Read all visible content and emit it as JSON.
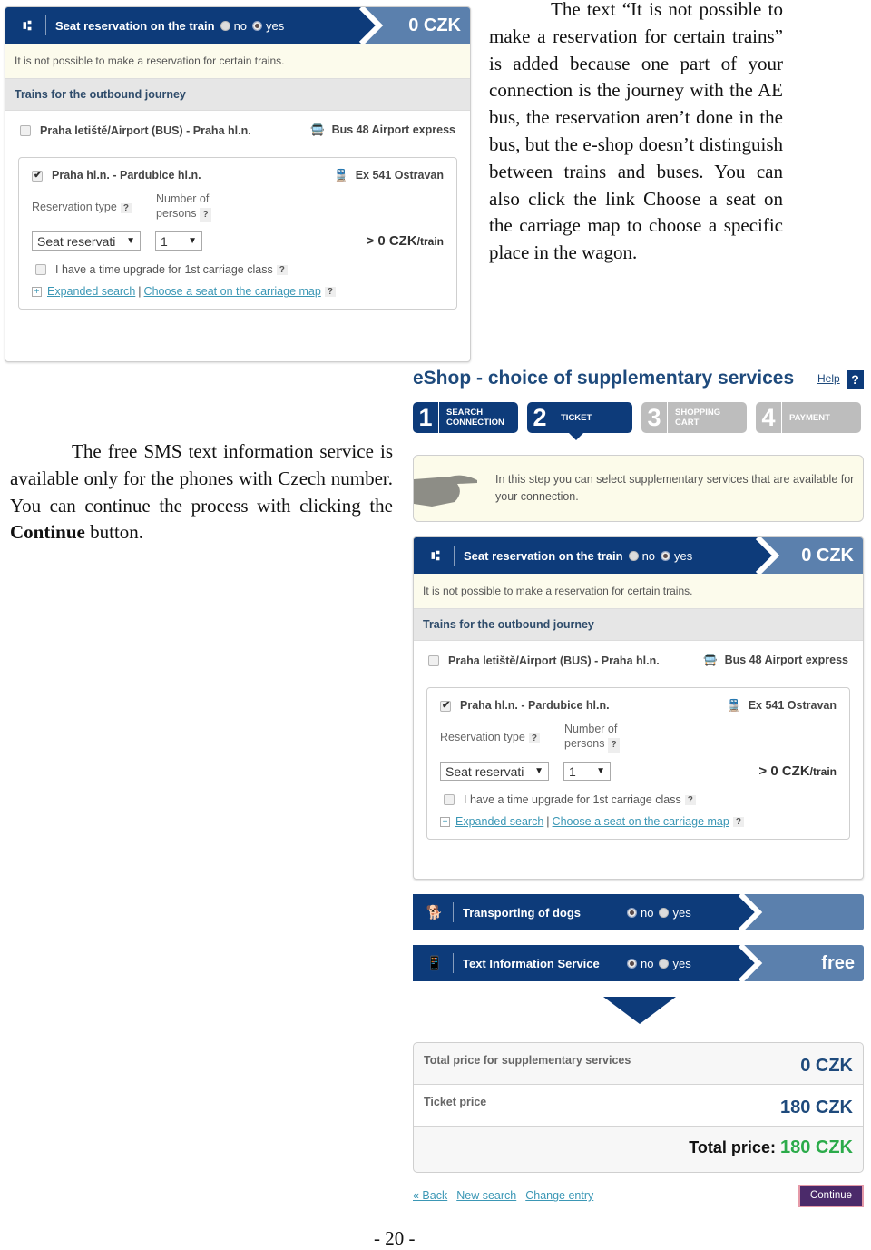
{
  "paragraphs": {
    "top_right": "The text “It is not possible to make a reservation for certain trains” is added because one part of your connection is the journey with the AE bus, the reservation aren’t done in the bus, but the e-shop doesn’t distinguish between trains and buses. You can also click the link Choose a seat on the carriage map to choose a specific place in the wagon.",
    "middle_left_before": "The free SMS text information service is available only for the phones with Czech number. You can continue the process with clicking the ",
    "middle_left_bold": "Continue",
    "middle_left_after": " button."
  },
  "reservation": {
    "title": "Seat reservation on the train",
    "icon": "seat-reservation-icon",
    "radio_no": "no",
    "radio_yes": "yes",
    "selected": "yes",
    "price": "0 CZK",
    "note": "It is not possible to make a reservation for certain trains.",
    "subheading": "Trains for the outbound journey",
    "bus_segment": {
      "route": "Praha letiště/Airport (BUS) - Praha hl.n.",
      "vehicle": "Bus 48 Airport express",
      "checked": false
    },
    "train_segment": {
      "route": "Praha hl.n. - Pardubice hl.n.",
      "vehicle": "Ex 541 Ostravan",
      "checked": true,
      "reservation_type_label": "Reservation type",
      "persons_label_1": "Number of",
      "persons_label_2": "persons",
      "reservation_type_value": "Seat reservati",
      "persons_value": "1",
      "price": "> 0 CZK",
      "price_unit": "/train",
      "upgrade_label": "I have a time upgrade for 1st carriage class",
      "expanded_search": "Expanded search",
      "carriage_map": "Choose a seat on the carriage map",
      "help": "?"
    }
  },
  "eshop": {
    "title": "eShop - choice of supplementary services",
    "help_label": "Help",
    "help_icon": "?",
    "steps": [
      {
        "num": "1",
        "line1": "SEARCH",
        "line2": "CONNECTION",
        "state": "done"
      },
      {
        "num": "2",
        "line1": "TICKET",
        "line2": "",
        "state": "current"
      },
      {
        "num": "3",
        "line1": "SHOPPING",
        "line2": "CART",
        "state": "inactive"
      },
      {
        "num": "4",
        "line1": "PAYMENT",
        "line2": "",
        "state": "inactive"
      }
    ],
    "hint": "In this step you can select supplementary services that are available for your connection.",
    "services": [
      {
        "title": "Transporting of dogs",
        "icon": "dog-icon",
        "no": "no",
        "yes": "yes",
        "selected": "no",
        "price": ""
      },
      {
        "title": "Text Information Service",
        "icon": "phone-icon",
        "no": "no",
        "yes": "yes",
        "selected": "no",
        "price": "free"
      }
    ],
    "totals": {
      "supplementary_label": "Total price for supplementary services",
      "supplementary_value": "0 CZK",
      "ticket_label": "Ticket price",
      "ticket_value": "180 CZK",
      "total_label": "Total price:",
      "total_value": "180 CZK"
    },
    "links": {
      "back": "« Back",
      "new_search": "New search",
      "change_entry": "Change entry"
    },
    "continue_label": "Continue"
  },
  "colors": {
    "navy": "#0d3b7a",
    "steel": "#5b80ad",
    "green": "#2bab4a",
    "link": "#3b97b5"
  },
  "page_number": "- 20 -"
}
